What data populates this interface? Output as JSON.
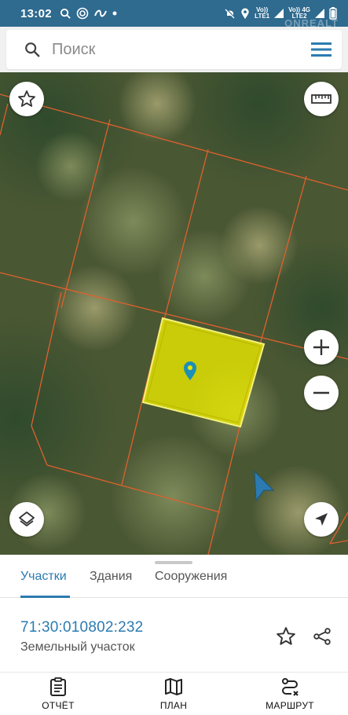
{
  "status_bar": {
    "time": "13:02",
    "sim1": "Vo))\nLTE1",
    "sim2": "Vo))\nLTE2",
    "net": "4G",
    "watermark": "ONREALT"
  },
  "search": {
    "placeholder": "Поиск"
  },
  "map": {
    "selected_parcel_color": "#e7e600",
    "boundary_color": "#e0602e"
  },
  "tabs": [
    {
      "label": "Участки",
      "active": true
    },
    {
      "label": "Здания",
      "active": false
    },
    {
      "label": "Сооружения",
      "active": false
    }
  ],
  "parcel": {
    "cadastral_number": "71:30:010802:232",
    "type": "Земельный участок"
  },
  "bottom_nav": [
    {
      "label": "ОТЧЁТ",
      "icon": "report-icon"
    },
    {
      "label": "ПЛАН",
      "icon": "map-plan-icon"
    },
    {
      "label": "МАРШРУТ",
      "icon": "route-icon"
    }
  ],
  "colors": {
    "accent": "#2b7bb0",
    "status_bar": "#2f6a8f"
  }
}
